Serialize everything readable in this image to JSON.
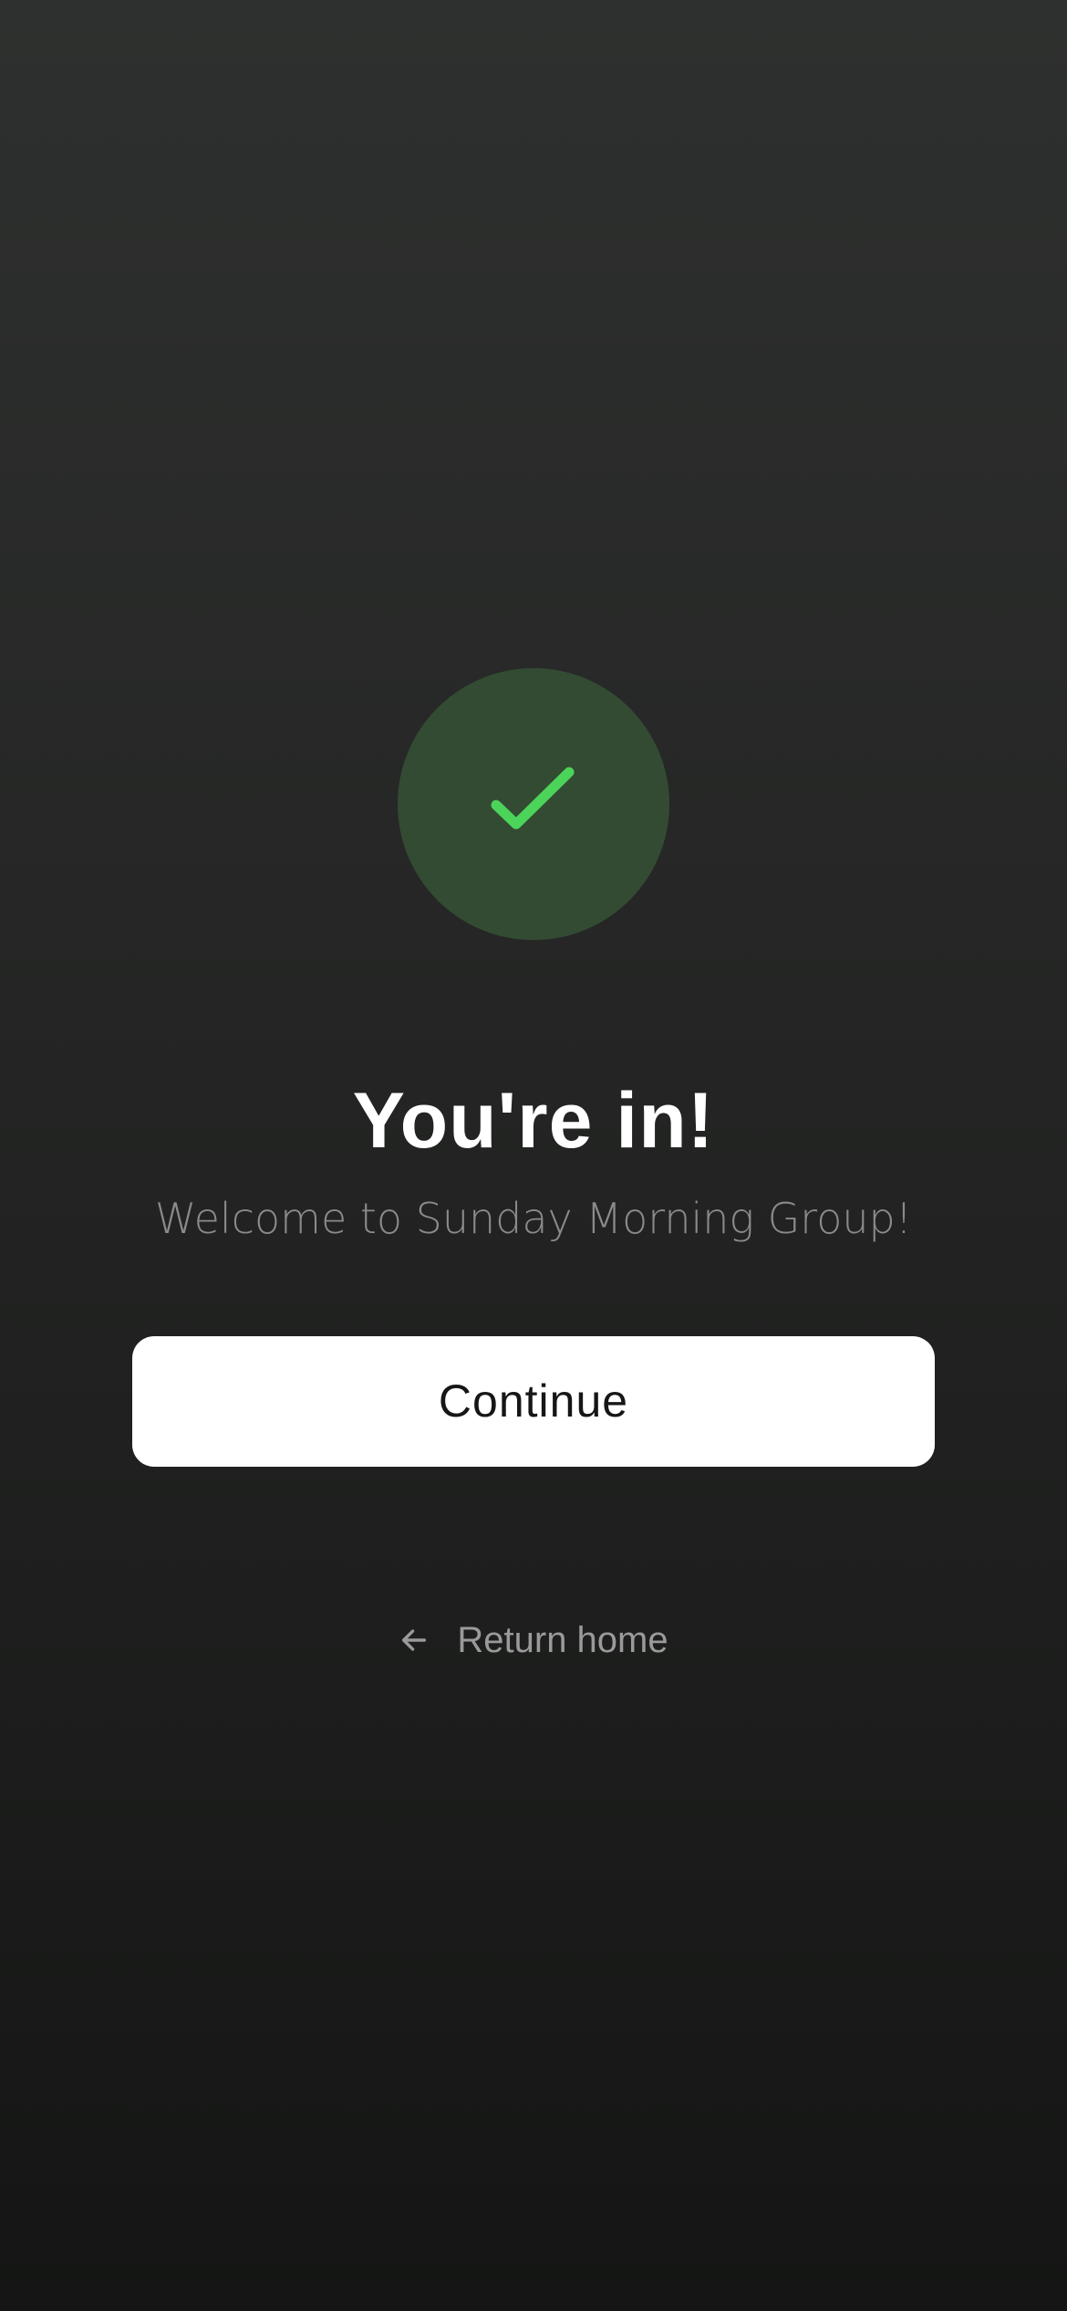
{
  "success": {
    "icon": "checkmark-icon",
    "circle_color": "#334b33",
    "check_color": "#4cd45a"
  },
  "main": {
    "title": "You're in!",
    "subtitle": "Welcome to Sunday Morning Group!"
  },
  "actions": {
    "continue_label": "Continue",
    "return_home_icon": "arrow-left-icon",
    "return_home_label": "Return home"
  }
}
